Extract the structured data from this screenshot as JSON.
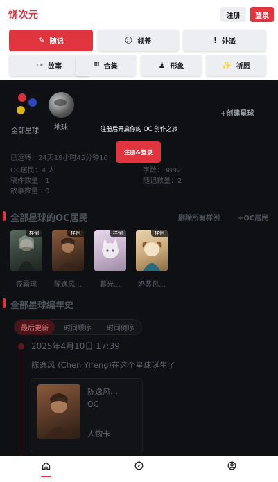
{
  "header": {
    "logo": "饼次元",
    "register": "注册",
    "login": "登录"
  },
  "nav": {
    "row1": [
      {
        "label": "随记",
        "icon": "✎",
        "active": true
      },
      {
        "label": "领养",
        "icon": "☺",
        "active": false
      },
      {
        "label": "外派",
        "icon": "!",
        "active": false
      }
    ],
    "row2": [
      {
        "label": "故事",
        "icon": "✑"
      },
      {
        "label": "合集",
        "icon": "⁞⁞⁞"
      },
      {
        "label": "形象",
        "icon": "♟"
      },
      {
        "label": "祈愿",
        "icon": "✨"
      }
    ]
  },
  "planets": {
    "all_label": "全部星球",
    "earth_label": "地球",
    "create": "+创建星球"
  },
  "overlay": {
    "prompt": "注册后开启你的 OC 创作之旅",
    "cta": "注册&登录"
  },
  "stats": {
    "uptime": "已运转：24天19小时45分钟10",
    "residents": "OC居民：4 人",
    "words": "字数：3892",
    "drafts": "稿件数量：1",
    "notes": "随记数量：2",
    "stories": "故事数量：0"
  },
  "residents_section": {
    "title": "全部星球的OC居民",
    "delete_samples": "删除所有样例",
    "add_resident": "+OC居民",
    "tag": "样例",
    "items": [
      {
        "name": "夜霜璃"
      },
      {
        "name": "陈逸风…"
      },
      {
        "name": "暮光…"
      },
      {
        "name": "奶黄包…"
      }
    ]
  },
  "chronicle": {
    "title": "全部星球编年史",
    "tabs": [
      "最后更新",
      "时间顺序",
      "时间倒序"
    ],
    "active_tab": 0,
    "entry": {
      "date": "2025年4月10日 17:39",
      "text": "陈逸风 (Chen Yifeng)在这个星球诞生了",
      "card_name": "陈逸风…",
      "card_type": "OC",
      "card_kind": "人物卡"
    }
  },
  "bottom_nav": {
    "home_icon": "home-icon",
    "explore_icon": "compass-icon",
    "profile_icon": "user-icon"
  },
  "colors": {
    "accent": "#e0343f",
    "background": "#0f1013"
  }
}
